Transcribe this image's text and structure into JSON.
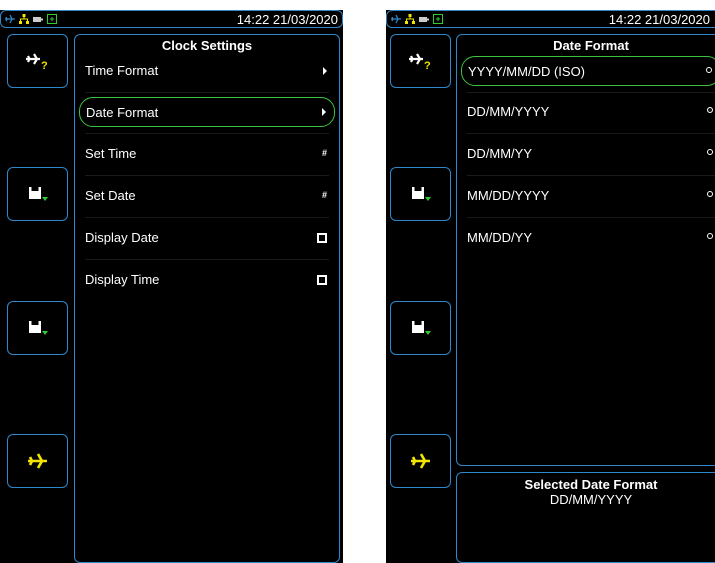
{
  "left_screen": {
    "status": {
      "clock": "14:22 21/03/2020",
      "icons": [
        "airplane-icon",
        "network-icon",
        "battery-icon",
        "power-icon"
      ]
    },
    "side_buttons": [
      {
        "icon": "airplane-help-icon"
      },
      {
        "icon": "save-icon"
      },
      {
        "icon": "save-icon"
      },
      {
        "icon": "airplane-icon"
      }
    ],
    "panel": {
      "title": "Clock Settings",
      "items": [
        {
          "label": "Time Format",
          "indicator": "arrow"
        },
        {
          "label": "Date Format",
          "indicator": "arrow",
          "selected": true
        },
        {
          "label": "Set Time",
          "indicator": "#"
        },
        {
          "label": "Set Date",
          "indicator": "#"
        },
        {
          "label": "Display Date",
          "indicator": "checkbox"
        },
        {
          "label": "Display Time",
          "indicator": "checkbox"
        }
      ]
    }
  },
  "right_screen": {
    "status": {
      "clock": "14:22 21/03/2020",
      "icons": [
        "airplane-icon",
        "network-icon",
        "battery-icon",
        "power-icon"
      ]
    },
    "side_buttons": [
      {
        "icon": "airplane-help-icon"
      },
      {
        "icon": "save-icon"
      },
      {
        "icon": "save-icon"
      },
      {
        "icon": "airplane-icon"
      }
    ],
    "panel": {
      "title": "Date Format",
      "options": [
        {
          "label": "YYYY/MM/DD (ISO)",
          "checked": false,
          "selected": true
        },
        {
          "label": "DD/MM/YYYY",
          "checked": true
        },
        {
          "label": "DD/MM/YY",
          "checked": false
        },
        {
          "label": "MM/DD/YYYY",
          "checked": false
        },
        {
          "label": "MM/DD/YY",
          "checked": false
        }
      ]
    },
    "selected_box": {
      "title": "Selected Date Format",
      "value": "DD/MM/YYYY"
    }
  },
  "colors": {
    "border": "#2f86c9",
    "highlight": "#3ec23e",
    "accent_yellow": "#f2e600",
    "accent_green": "#2ecc2e"
  }
}
